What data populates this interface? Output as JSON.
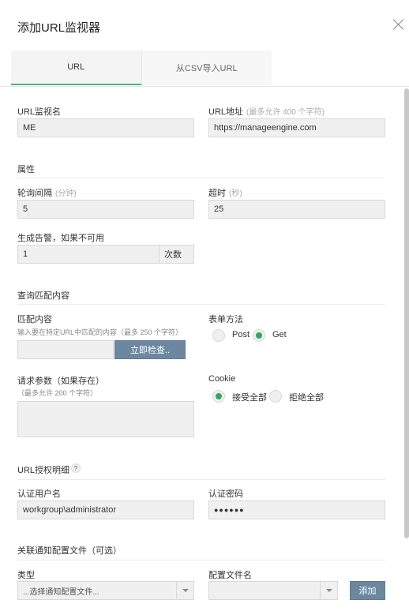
{
  "dialog": {
    "title": "添加URL监视器"
  },
  "tabs": [
    {
      "label": "URL",
      "active": true
    },
    {
      "label": "从CSV导入URL",
      "active": false
    }
  ],
  "fields": {
    "monitor_name": {
      "label": "URL监视名",
      "value": "ME"
    },
    "url_address": {
      "label": "URL地址",
      "hint": "(最多允许 400 个字符)",
      "value": "https://manageengine.com"
    }
  },
  "properties": {
    "section_title": "属性",
    "poll_interval": {
      "label": "轮询间隔",
      "hint": "(分钟)",
      "value": "5"
    },
    "timeout": {
      "label": "超时",
      "hint": "(秒)",
      "value": "25"
    },
    "alert": {
      "label": "生成告警，如果不可用",
      "value": "1",
      "unit": "次数"
    }
  },
  "query": {
    "section_title": "查询匹配内容",
    "match_content": {
      "label": "匹配内容",
      "hint": "输入要在特定URL中匹配的内容（最多 250 个字符）",
      "value": "",
      "check_button": "立即检查.."
    },
    "form_method": {
      "label": "表单方法",
      "options": [
        "Post",
        "Get"
      ],
      "selected": "Get"
    },
    "request_params": {
      "label": "请求参数（如果存在）",
      "hint": "（最多允许 200 个字符）",
      "value": ""
    },
    "cookie": {
      "label": "Cookie",
      "options": [
        "接受全部",
        "拒绝全部"
      ],
      "selected": "接受全部"
    }
  },
  "auth": {
    "section_title": "URL授权明细",
    "help_icon": "?",
    "username": {
      "label": "认证用户名",
      "value": "workgroup\\administrator"
    },
    "password": {
      "label": "认证密码",
      "value": "●●●●●●"
    }
  },
  "notification": {
    "section_title": "关联通知配置文件（可选）",
    "type": {
      "label": "类型",
      "selected": "...选择通知配置文件..."
    },
    "profile_name": {
      "label": "配置文件名",
      "selected": ""
    },
    "add_button": "添加"
  },
  "colors": {
    "accent": "#4caf73",
    "button": "#6d87a1",
    "radio_on": "#33a662"
  }
}
